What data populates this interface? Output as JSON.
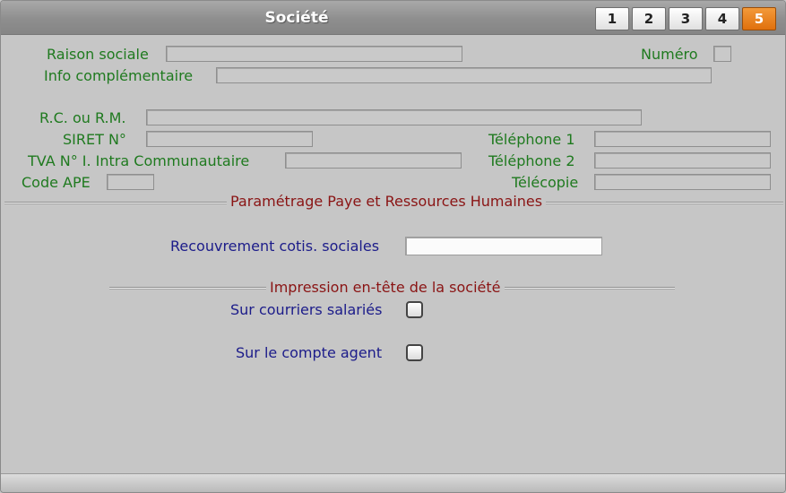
{
  "window": {
    "title": "Société"
  },
  "tabs": [
    "1",
    "2",
    "3",
    "4",
    "5"
  ],
  "active_tab": "5",
  "labels": {
    "raison_sociale": "Raison sociale",
    "numero": "Numéro",
    "info_complementaire": "Info complémentaire",
    "rc_rm": "R.C. ou R.M.",
    "siret": "SIRET N°",
    "telephone1": "Téléphone 1",
    "tva": "TVA N° I. Intra Communautaire",
    "telephone2": "Téléphone 2",
    "code_ape": "Code APE",
    "telecopie": "Télécopie",
    "recouvrement": "Recouvrement cotis. sociales",
    "sur_courriers": "Sur courriers salariés",
    "sur_compte_agent": "Sur le compte agent"
  },
  "fields": {
    "raison_sociale": "",
    "numero": "",
    "info_complementaire": "",
    "rc_rm": "",
    "siret": "",
    "telephone1": "",
    "tva": "",
    "telephone2": "",
    "code_ape": "",
    "telecopie": "",
    "recouvrement": ""
  },
  "sections": {
    "paye": "Paramétrage Paye et Ressources Humaines",
    "impression": "Impression en-tête de la société"
  },
  "checkboxes": {
    "sur_courriers": false,
    "sur_compte_agent": false
  }
}
